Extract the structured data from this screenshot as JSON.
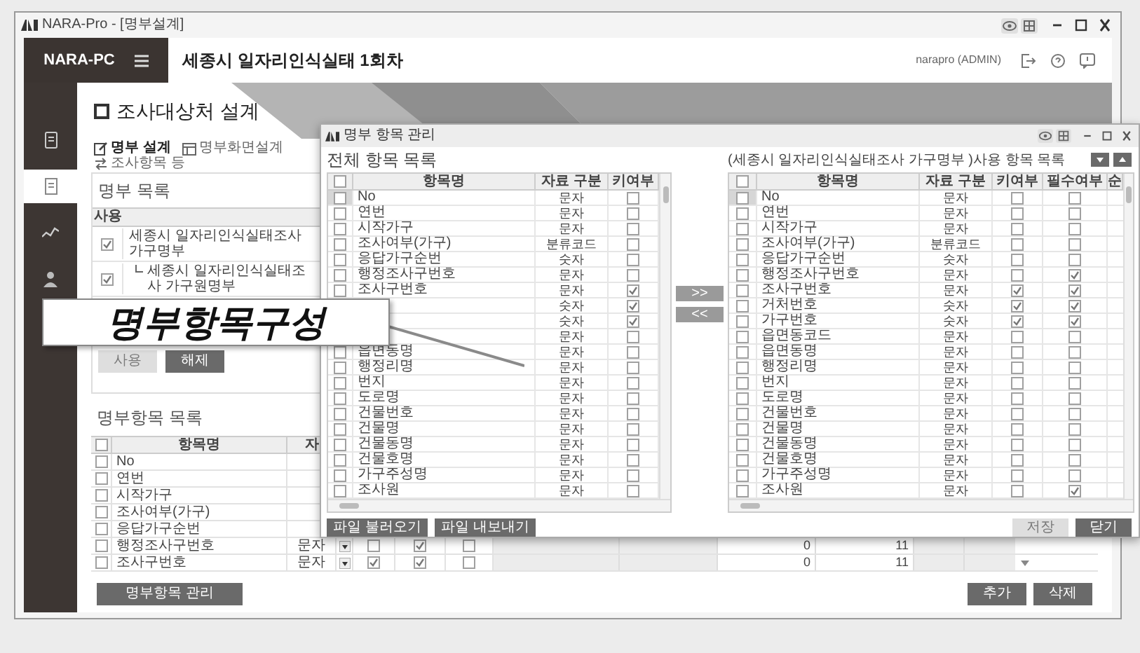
{
  "window": {
    "title": "NARA-Pro - [명부설계]"
  },
  "header": {
    "brand": "NARA-PC",
    "project_title": "세종시 일자리인식실태 1회차",
    "user": "narapro (ADMIN)"
  },
  "sidebar": {
    "items": [
      {
        "kind": "document",
        "selected": false
      },
      {
        "kind": "page",
        "selected": true
      },
      {
        "kind": "trend",
        "selected": false
      },
      {
        "kind": "person",
        "selected": false
      }
    ]
  },
  "page_title": "조사대상처 설계",
  "toolbar": [
    {
      "kind": "edit",
      "label": "명부 설계",
      "selected": true
    },
    {
      "kind": "screen",
      "label": "명부화면설계",
      "selected": false
    },
    {
      "kind": "swap",
      "label": "조사항목 등",
      "selected": false
    }
  ],
  "roster_list": {
    "title": "명부 목록",
    "column": "사용",
    "rows": [
      {
        "name": "세종시 일자리인식실태조사 가구명부",
        "checked": true,
        "children": [
          {
            "name": "세종시 일자리인식실태조사 가구원명부",
            "checked": true
          }
        ]
      }
    ],
    "buttons": [
      {
        "label": "사용",
        "disabled": true
      },
      {
        "label": "해제",
        "disabled": false
      }
    ]
  },
  "item_list": {
    "title": "명부항목 목록",
    "all_checked": false,
    "columns": [
      "항목명",
      "자"
    ],
    "rows": [
      {
        "name": "No",
        "checked": false
      },
      {
        "name": "연번",
        "checked": false
      },
      {
        "name": "시작가구",
        "checked": false
      },
      {
        "name": "조사여부(가구)",
        "checked": false
      },
      {
        "name": "응답가구순번",
        "checked": false
      },
      {
        "name": "행정조사구번호",
        "checked": false,
        "type": "문자",
        "flags": [
          {
            "checked": false
          },
          {
            "checked": true
          },
          {
            "checked": false
          }
        ],
        "values": [
          "0",
          "11"
        ]
      },
      {
        "name": "조사구번호",
        "checked": false,
        "type": "문자",
        "flags": [
          {
            "checked": true
          },
          {
            "checked": true
          },
          {
            "checked": false
          }
        ],
        "values": [
          "0",
          "11"
        ]
      }
    ],
    "manage_button": "명부항목 관리",
    "buttons": [
      "추가",
      "삭제"
    ]
  },
  "dialog": {
    "title": "명부 항목 관리",
    "all_items": {
      "title": "전체 항목 목록",
      "all_checked": false,
      "columns": [
        "항목명",
        "자료 구분",
        "키여부"
      ],
      "rows": [
        {
          "name": "No",
          "type": "문자",
          "key": false,
          "checked": false,
          "selected": true
        },
        {
          "name": "연번",
          "type": "문자",
          "key": false,
          "checked": false,
          "selected": false
        },
        {
          "name": "시작가구",
          "type": "문자",
          "key": false,
          "checked": false,
          "selected": false
        },
        {
          "name": "조사여부(가구)",
          "type": "분류코드",
          "key": false,
          "checked": false,
          "selected": false
        },
        {
          "name": "응답가구순번",
          "type": "숫자",
          "key": false,
          "checked": false,
          "selected": false
        },
        {
          "name": "행정조사구번호",
          "type": "문자",
          "key": false,
          "checked": false,
          "selected": false
        },
        {
          "name": "조사구번호",
          "type": "문자",
          "key": true,
          "checked": false,
          "selected": false
        },
        {
          "type": "숫자",
          "key": true
        },
        {
          "type": "숫자",
          "key": true
        },
        {
          "type": "문자",
          "key": false
        },
        {
          "name": "읍면동명",
          "type": "문자",
          "key": false,
          "checked": false,
          "selected": false
        },
        {
          "name": "행정리명",
          "type": "문자",
          "key": false,
          "checked": false,
          "selected": false
        },
        {
          "name": "번지",
          "type": "문자",
          "key": false,
          "checked": false,
          "selected": false
        },
        {
          "name": "도로명",
          "type": "문자",
          "key": false,
          "checked": false,
          "selected": false
        },
        {
          "name": "건물번호",
          "type": "문자",
          "key": false,
          "checked": false,
          "selected": false
        },
        {
          "name": "건물명",
          "type": "문자",
          "key": false,
          "checked": false,
          "selected": false
        },
        {
          "name": "건물동명",
          "type": "문자",
          "key": false,
          "checked": false,
          "selected": false
        },
        {
          "name": "건물호명",
          "type": "문자",
          "key": false,
          "checked": false,
          "selected": false
        },
        {
          "name": "가구주성명",
          "type": "문자",
          "key": false,
          "checked": false,
          "selected": false
        },
        {
          "name": "조사원",
          "type": "문자",
          "key": false,
          "checked": false,
          "selected": false
        }
      ],
      "buttons": [
        "파일 불러오기",
        "파일 내보내기"
      ]
    },
    "move_buttons": [
      ">>",
      "<<"
    ],
    "used_items": {
      "title": "(세종시 일자리인식실태조사 가구명부 )사용 항목 목록",
      "all_checked": false,
      "columns": [
        "항목명",
        "자료 구분",
        "키여부",
        "필수여부",
        "순"
      ],
      "rows": [
        {
          "name": "No",
          "type": "문자",
          "key": false,
          "required": false,
          "checked": false,
          "selected": true
        },
        {
          "name": "연번",
          "type": "문자",
          "key": false,
          "required": false,
          "checked": false,
          "selected": false
        },
        {
          "name": "시작가구",
          "type": "문자",
          "key": false,
          "required": false,
          "checked": false,
          "selected": false
        },
        {
          "name": "조사여부(가구)",
          "type": "분류코드",
          "key": false,
          "required": false,
          "checked": false,
          "selected": false
        },
        {
          "name": "응답가구순번",
          "type": "숫자",
          "key": false,
          "required": false,
          "checked": false,
          "selected": false
        },
        {
          "name": "행정조사구번호",
          "type": "문자",
          "key": false,
          "required": true,
          "checked": false,
          "selected": false
        },
        {
          "name": "조사구번호",
          "type": "문자",
          "key": true,
          "required": true,
          "checked": false,
          "selected": false
        },
        {
          "name": "거처번호",
          "type": "숫자",
          "key": true,
          "required": true,
          "checked": false,
          "selected": false
        },
        {
          "name": "가구번호",
          "type": "숫자",
          "key": true,
          "required": true,
          "checked": false,
          "selected": false
        },
        {
          "name": "읍면동코드",
          "type": "문자",
          "key": false,
          "required": false,
          "checked": false,
          "selected": false
        },
        {
          "name": "읍면동명",
          "type": "문자",
          "key": false,
          "required": false,
          "checked": false,
          "selected": false
        },
        {
          "name": "행정리명",
          "type": "문자",
          "key": false,
          "required": false,
          "checked": false,
          "selected": false
        },
        {
          "name": "번지",
          "type": "문자",
          "key": false,
          "required": false,
          "checked": false,
          "selected": false
        },
        {
          "name": "도로명",
          "type": "문자",
          "key": false,
          "required": false,
          "checked": false,
          "selected": false
        },
        {
          "name": "건물번호",
          "type": "문자",
          "key": false,
          "required": false,
          "checked": false,
          "selected": false
        },
        {
          "name": "건물명",
          "type": "문자",
          "key": false,
          "required": false,
          "checked": false,
          "selected": false
        },
        {
          "name": "건물동명",
          "type": "문자",
          "key": false,
          "required": false,
          "checked": false,
          "selected": false
        },
        {
          "name": "건물호명",
          "type": "문자",
          "key": false,
          "required": false,
          "checked": false,
          "selected": false
        },
        {
          "name": "가구주성명",
          "type": "문자",
          "key": false,
          "required": false,
          "checked": false,
          "selected": false
        },
        {
          "name": "조사원",
          "type": "문자",
          "key": false,
          "required": true,
          "checked": false,
          "selected": false
        }
      ],
      "buttons": [
        {
          "label": "저장",
          "disabled": true
        },
        {
          "label": "닫기",
          "disabled": false
        }
      ]
    }
  },
  "callout": {
    "text": "명부항목구성"
  }
}
